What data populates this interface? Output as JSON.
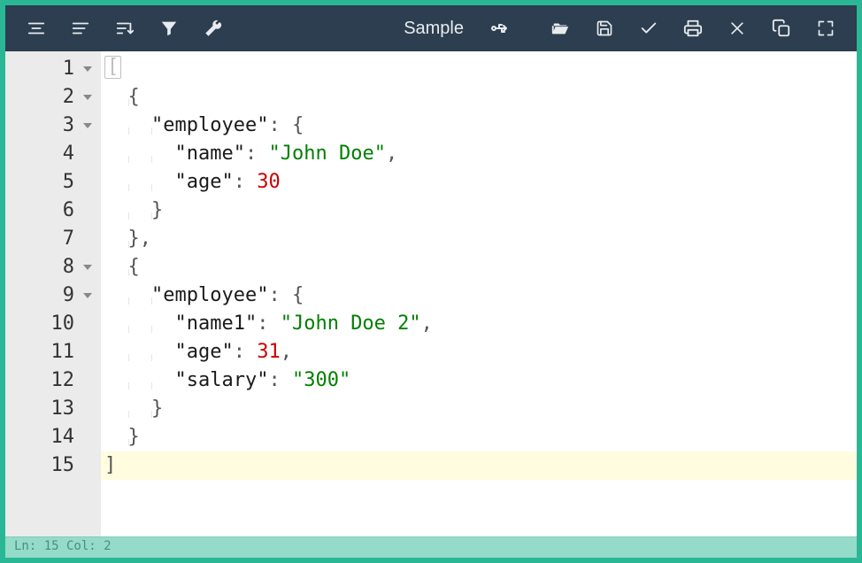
{
  "toolbar": {
    "sample_label": "Sample",
    "icons": {
      "format_left": "format-indent-left-icon",
      "format_right": "format-indent-right-icon",
      "sort": "sort-icon",
      "filter": "filter-icon",
      "wrench": "wrench-icon",
      "usb": "usb-icon",
      "open": "folder-open-icon",
      "save": "save-icon",
      "check": "check-icon",
      "print": "print-icon",
      "close": "close-icon",
      "copy": "copy-icon",
      "expand": "expand-icon"
    }
  },
  "editor": {
    "line_numbers": [
      "1",
      "2",
      "3",
      "4",
      "5",
      "6",
      "7",
      "8",
      "9",
      "10",
      "11",
      "12",
      "13",
      "14",
      "15"
    ],
    "foldable": [
      true,
      true,
      true,
      false,
      false,
      false,
      false,
      true,
      true,
      false,
      false,
      false,
      false,
      false,
      false
    ],
    "tokens": [
      [
        {
          "t": "brk",
          "v": "["
        }
      ],
      [
        {
          "t": "sp",
          "v": "  "
        },
        {
          "t": "ind",
          "v": ""
        },
        {
          "t": "p",
          "v": "{"
        }
      ],
      [
        {
          "t": "sp",
          "v": "  "
        },
        {
          "t": "ind",
          "v": ""
        },
        {
          "t": "sp",
          "v": "  "
        },
        {
          "t": "ind",
          "v": ""
        },
        {
          "t": "k",
          "v": "\"employee\""
        },
        {
          "t": "p",
          "v": ": {"
        }
      ],
      [
        {
          "t": "sp",
          "v": "  "
        },
        {
          "t": "ind",
          "v": ""
        },
        {
          "t": "sp",
          "v": "  "
        },
        {
          "t": "ind",
          "v": ""
        },
        {
          "t": "sp",
          "v": "  "
        },
        {
          "t": "k",
          "v": "\"name\""
        },
        {
          "t": "p",
          "v": ": "
        },
        {
          "t": "s",
          "v": "\"John Doe\""
        },
        {
          "t": "p",
          "v": ","
        }
      ],
      [
        {
          "t": "sp",
          "v": "  "
        },
        {
          "t": "ind",
          "v": ""
        },
        {
          "t": "sp",
          "v": "  "
        },
        {
          "t": "ind",
          "v": ""
        },
        {
          "t": "sp",
          "v": "  "
        },
        {
          "t": "k",
          "v": "\"age\""
        },
        {
          "t": "p",
          "v": ": "
        },
        {
          "t": "n",
          "v": "30"
        }
      ],
      [
        {
          "t": "sp",
          "v": "  "
        },
        {
          "t": "ind",
          "v": ""
        },
        {
          "t": "sp",
          "v": "  "
        },
        {
          "t": "ind",
          "v": ""
        },
        {
          "t": "p",
          "v": "}"
        }
      ],
      [
        {
          "t": "sp",
          "v": "  "
        },
        {
          "t": "ind",
          "v": ""
        },
        {
          "t": "p",
          "v": "},"
        }
      ],
      [
        {
          "t": "sp",
          "v": "  "
        },
        {
          "t": "ind",
          "v": ""
        },
        {
          "t": "p",
          "v": "{"
        }
      ],
      [
        {
          "t": "sp",
          "v": "  "
        },
        {
          "t": "ind",
          "v": ""
        },
        {
          "t": "sp",
          "v": "  "
        },
        {
          "t": "ind",
          "v": ""
        },
        {
          "t": "k",
          "v": "\"employee\""
        },
        {
          "t": "p",
          "v": ": {"
        }
      ],
      [
        {
          "t": "sp",
          "v": "  "
        },
        {
          "t": "ind",
          "v": ""
        },
        {
          "t": "sp",
          "v": "  "
        },
        {
          "t": "ind",
          "v": ""
        },
        {
          "t": "sp",
          "v": "  "
        },
        {
          "t": "k",
          "v": "\"name1\""
        },
        {
          "t": "p",
          "v": ": "
        },
        {
          "t": "s",
          "v": "\"John Doe 2\""
        },
        {
          "t": "p",
          "v": ","
        }
      ],
      [
        {
          "t": "sp",
          "v": "  "
        },
        {
          "t": "ind",
          "v": ""
        },
        {
          "t": "sp",
          "v": "  "
        },
        {
          "t": "ind",
          "v": ""
        },
        {
          "t": "sp",
          "v": "  "
        },
        {
          "t": "k",
          "v": "\"age\""
        },
        {
          "t": "p",
          "v": ": "
        },
        {
          "t": "n",
          "v": "31"
        },
        {
          "t": "p",
          "v": ","
        }
      ],
      [
        {
          "t": "sp",
          "v": "  "
        },
        {
          "t": "ind",
          "v": ""
        },
        {
          "t": "sp",
          "v": "  "
        },
        {
          "t": "ind",
          "v": ""
        },
        {
          "t": "sp",
          "v": "  "
        },
        {
          "t": "k",
          "v": "\"salary\""
        },
        {
          "t": "p",
          "v": ": "
        },
        {
          "t": "s",
          "v": "\"300\""
        }
      ],
      [
        {
          "t": "sp",
          "v": "  "
        },
        {
          "t": "ind",
          "v": ""
        },
        {
          "t": "sp",
          "v": "  "
        },
        {
          "t": "ind",
          "v": ""
        },
        {
          "t": "p",
          "v": "}"
        }
      ],
      [
        {
          "t": "sp",
          "v": "  "
        },
        {
          "t": "ind",
          "v": ""
        },
        {
          "t": "p",
          "v": "}"
        }
      ],
      [
        {
          "t": "p",
          "v": "]"
        }
      ]
    ],
    "highlight_line": 15
  },
  "status": {
    "text": "Ln: 15   Col: 2"
  }
}
